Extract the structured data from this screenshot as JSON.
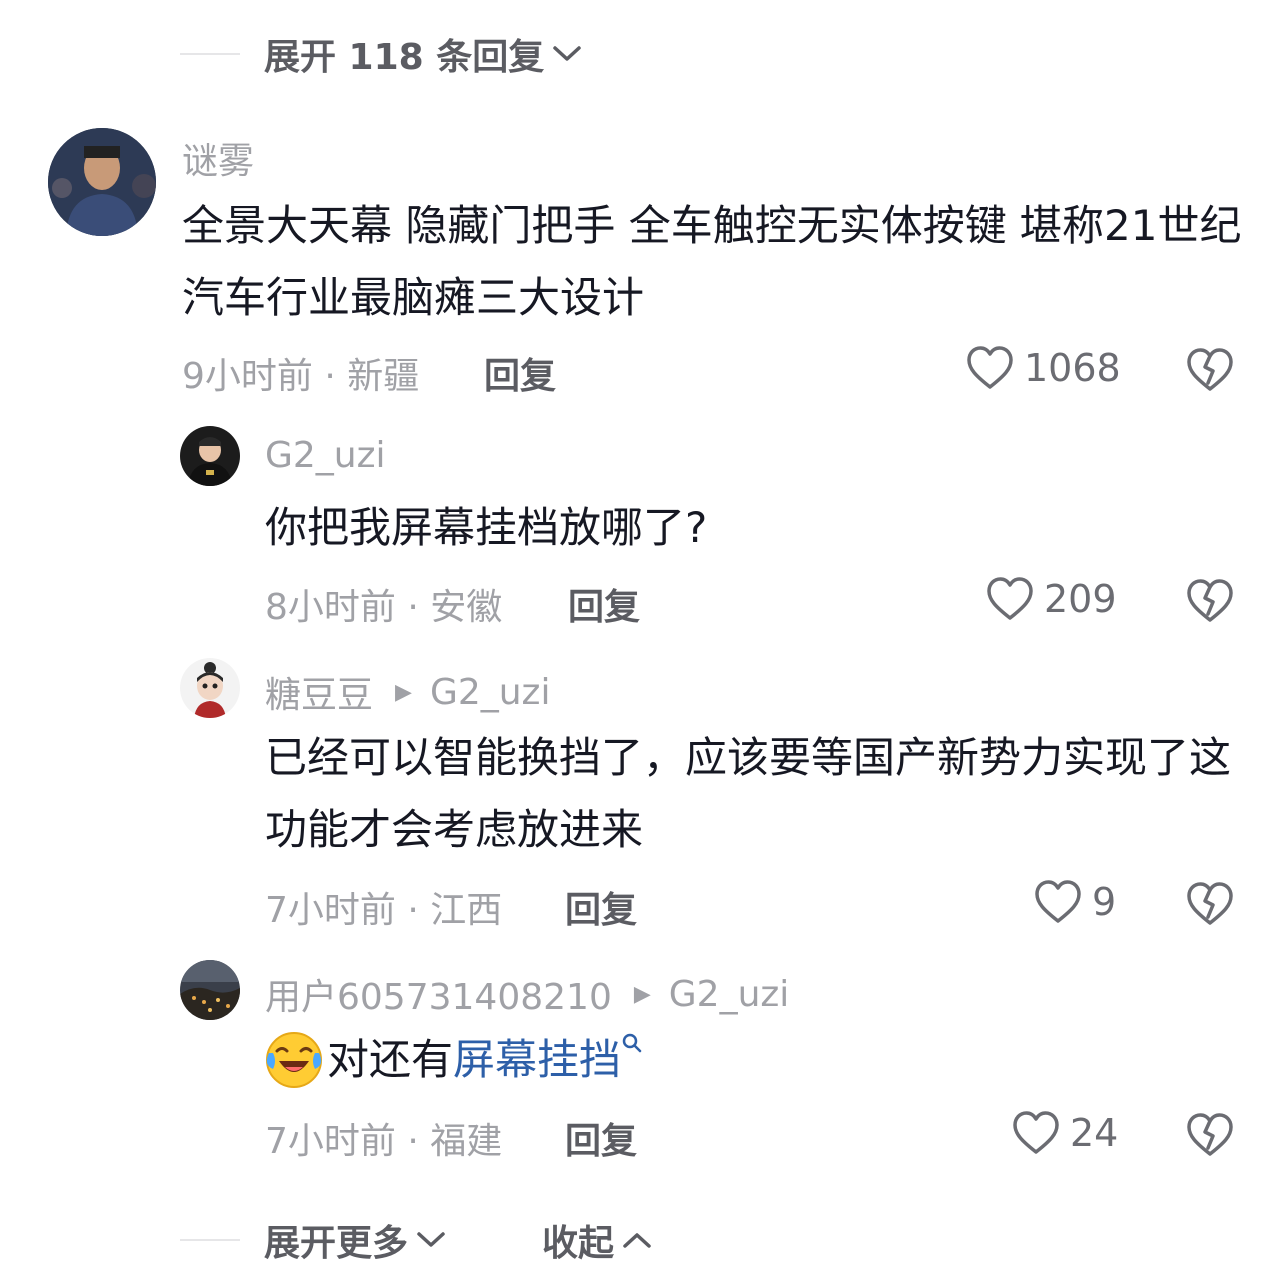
{
  "top_expand": {
    "label": "展开 118 条回复"
  },
  "comments": [
    {
      "username": "谜雾",
      "text": "全景大天幕 隐藏门把手 全车触控无实体按键 堪称21世纪汽车行业最脑瘫三大设计",
      "meta": "9小时前 · 新疆",
      "reply_label": "回复",
      "likes": "1068"
    },
    {
      "username": "G2_uzi",
      "text": "你把我屏幕挂档放哪了?",
      "meta": "8小时前 · 安徽",
      "reply_label": "回复",
      "likes": "209"
    },
    {
      "username": "糖豆豆",
      "reply_to": "G2_uzi",
      "text": "已经可以智能换挡了，应该要等国产新势力实现了这功能才会考虑放进来",
      "meta": "7小时前 · 江西",
      "reply_label": "回复",
      "likes": "9"
    },
    {
      "username": "用户605731408210",
      "reply_to": "G2_uzi",
      "text": "对还有",
      "link_text": "屏幕挂挡",
      "meta": "7小时前 · 福建",
      "reply_label": "回复",
      "likes": "24"
    }
  ],
  "bottom": {
    "expand_more": "展开更多",
    "collapse": "收起"
  },
  "colors": {
    "link": "#2d5fa8",
    "secondary_text": "#a0a1a6",
    "primary_text": "#161823"
  }
}
